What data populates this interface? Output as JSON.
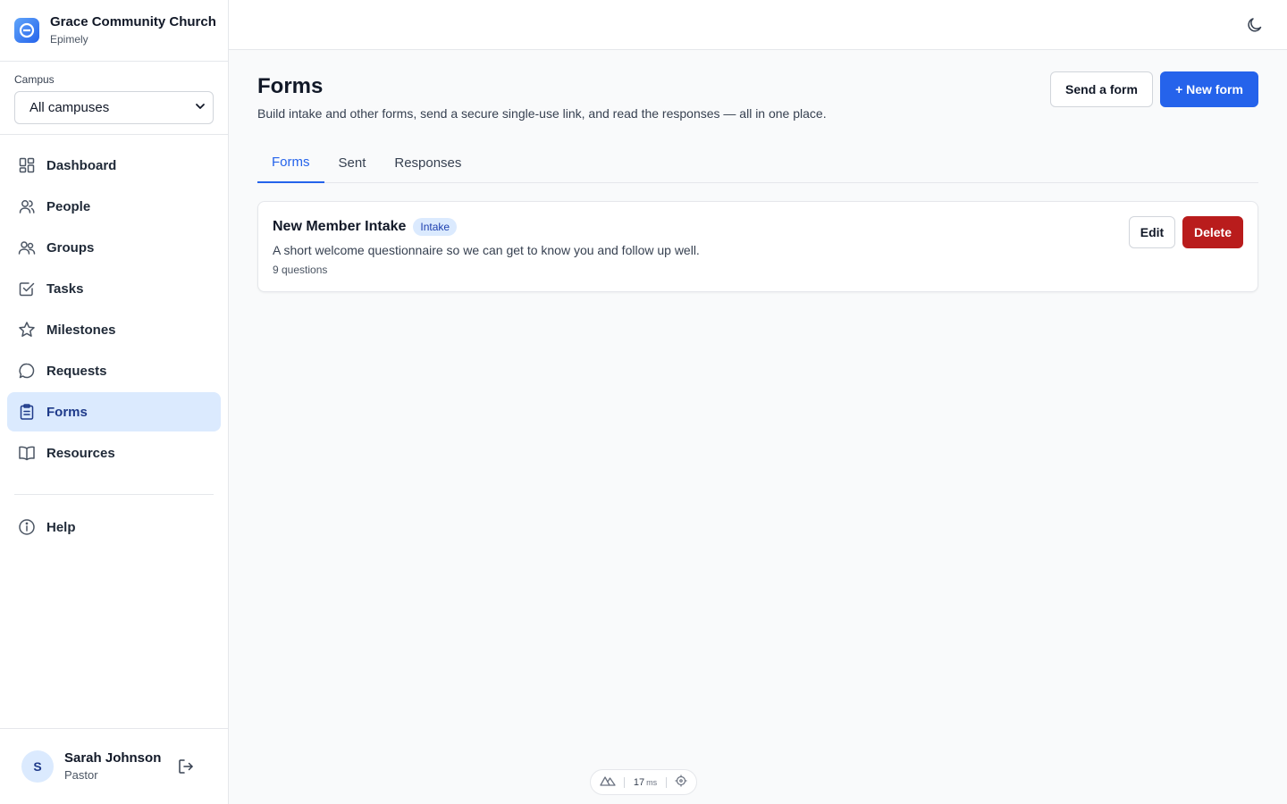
{
  "brand": {
    "name": "Grace Community Church",
    "subtitle": "Epimely",
    "logo_icon": "epimely-logo-icon"
  },
  "campus": {
    "label": "Campus",
    "selected": "All campuses"
  },
  "nav": {
    "items": [
      {
        "label": "Dashboard",
        "icon": "dashboard-icon"
      },
      {
        "label": "People",
        "icon": "people-icon"
      },
      {
        "label": "Groups",
        "icon": "groups-icon"
      },
      {
        "label": "Tasks",
        "icon": "tasks-icon"
      },
      {
        "label": "Milestones",
        "icon": "star-icon"
      },
      {
        "label": "Requests",
        "icon": "chat-icon"
      },
      {
        "label": "Forms",
        "icon": "clipboard-icon",
        "active": true
      },
      {
        "label": "Resources",
        "icon": "book-icon"
      }
    ],
    "help": {
      "label": "Help",
      "icon": "info-icon"
    }
  },
  "user": {
    "initial": "S",
    "name": "Sarah Johnson",
    "role": "Pastor"
  },
  "page": {
    "title": "Forms",
    "description": "Build intake and other forms, send a secure single-use link, and read the responses — all in one place.",
    "send_label": "Send a form",
    "new_label": "+ New form"
  },
  "tabs": [
    {
      "label": "Forms",
      "active": true
    },
    {
      "label": "Sent"
    },
    {
      "label": "Responses"
    }
  ],
  "forms": [
    {
      "title": "New Member Intake",
      "badge": "Intake",
      "description": "A short welcome questionnaire so we can get to know you and follow up well.",
      "meta": "9 questions",
      "edit_label": "Edit",
      "delete_label": "Delete"
    }
  ],
  "devtools": {
    "time": "17",
    "unit": "ms"
  },
  "colors": {
    "accent": "#2563eb",
    "active_nav_bg": "#dbeafe",
    "danger": "#b91c1c"
  }
}
